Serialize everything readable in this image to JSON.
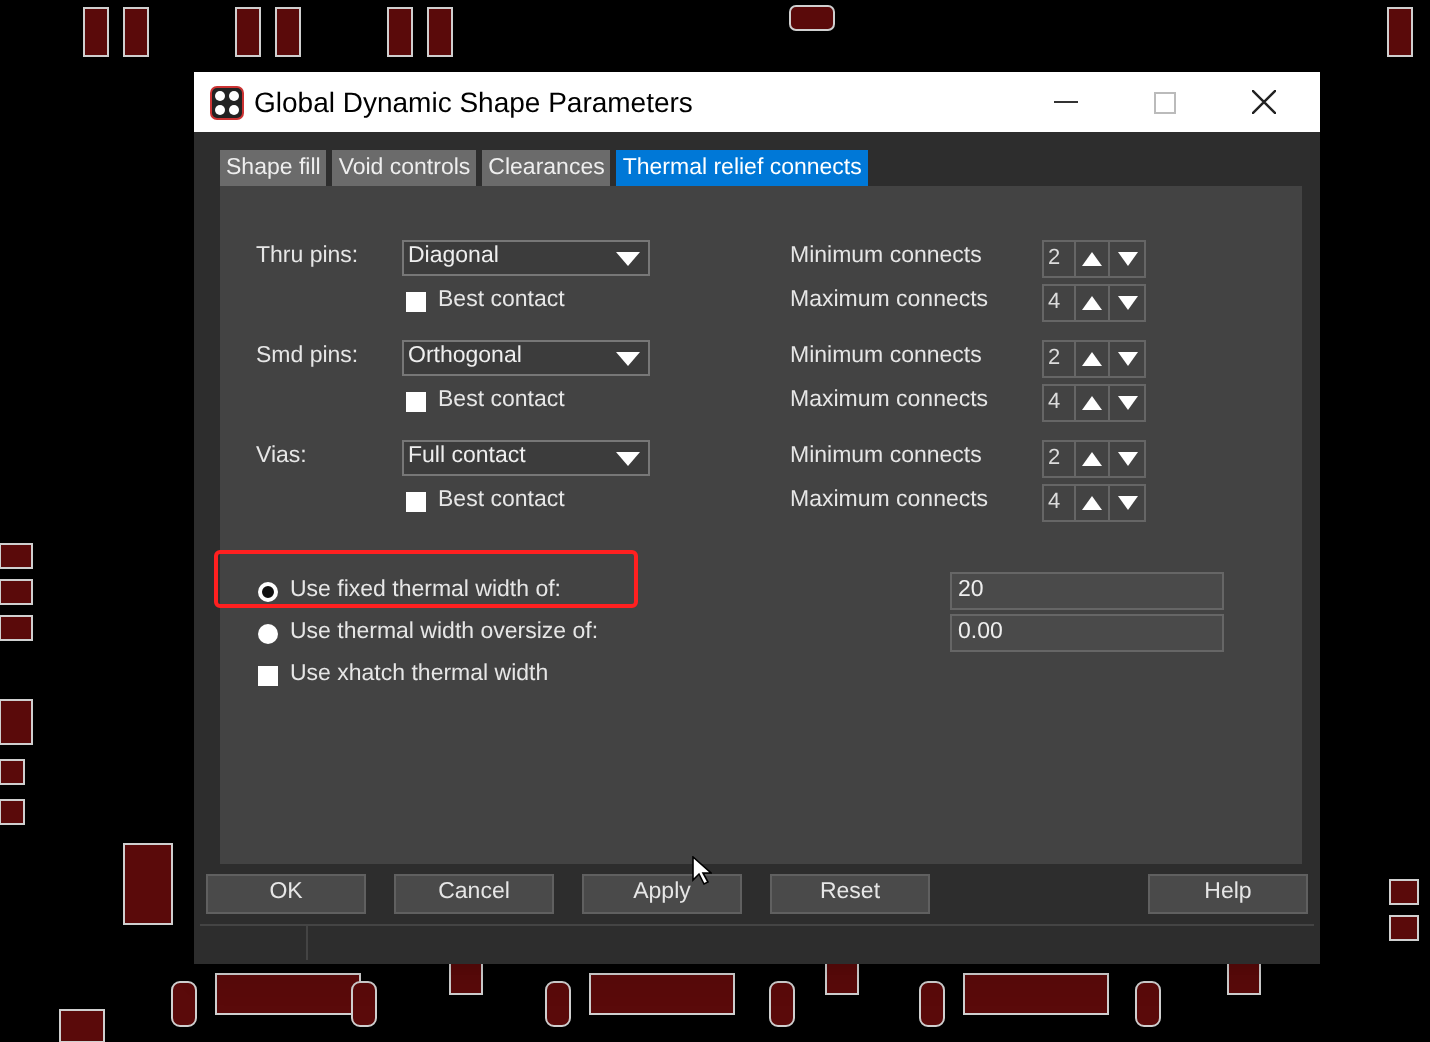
{
  "window": {
    "title": "Global Dynamic Shape Parameters"
  },
  "tabs": [
    {
      "label": "Shape fill",
      "selected": false
    },
    {
      "label": "Void controls",
      "selected": false
    },
    {
      "label": "Clearances",
      "selected": false
    },
    {
      "label": "Thermal relief connects",
      "selected": true
    }
  ],
  "pin_groups": [
    {
      "label": "Thru pins:",
      "pattern": "Diagonal",
      "best_contact_label": "Best contact",
      "best_contact": false,
      "min_label": "Minimum connects",
      "min_value": "2",
      "max_label": "Maximum connects",
      "max_value": "4"
    },
    {
      "label": "Smd pins:",
      "pattern": "Orthogonal",
      "best_contact_label": "Best contact",
      "best_contact": false,
      "min_label": "Minimum connects",
      "min_value": "2",
      "max_label": "Maximum connects",
      "max_value": "4"
    },
    {
      "label": "Vias:",
      "pattern": "Full contact",
      "best_contact_label": "Best contact",
      "best_contact": false,
      "min_label": "Minimum connects",
      "min_value": "2",
      "max_label": "Maximum connects",
      "max_value": "4"
    }
  ],
  "width_options": [
    {
      "kind": "radio",
      "label": "Use fixed thermal width of:",
      "selected": true,
      "value": "20",
      "highlighted": true
    },
    {
      "kind": "radio",
      "label": "Use thermal width oversize of:",
      "selected": false,
      "value": "0.00",
      "highlighted": false
    },
    {
      "kind": "checkbox",
      "label": "Use xhatch thermal width",
      "checked": false
    }
  ],
  "buttons": [
    "OK",
    "Cancel",
    "Apply",
    "Reset",
    "Help"
  ]
}
